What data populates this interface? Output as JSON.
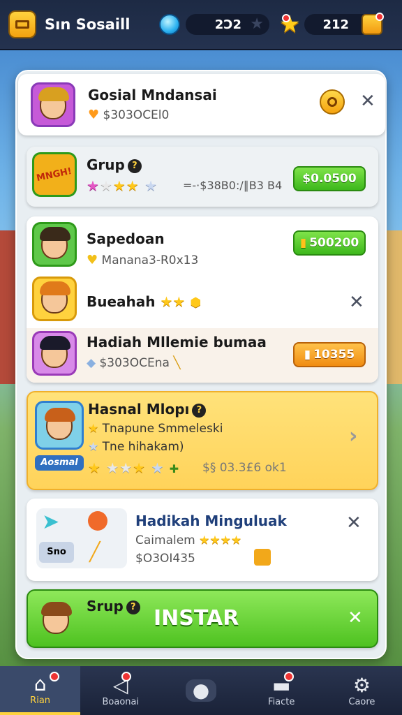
{
  "header": {
    "title": "Sın Sosaill",
    "gems_value": "2Ɔ2",
    "stars_value": "212",
    "colors": {
      "bar": "#1d2a44",
      "gold": "#ffcc1a"
    }
  },
  "cards": {
    "c1": {
      "name": "Gosial Mndansai",
      "sub": "$303OCEl0"
    },
    "c2": {
      "name": "Grup",
      "stars_text": "=-·$38B0:∕∥B3 B4",
      "button": "$0.0500"
    },
    "c3": {
      "name": "Sapedoan",
      "sub": "Manana3-R0x13",
      "button": "500200"
    },
    "c4": {
      "name": "Bueahah"
    },
    "c5": {
      "name": "Hadiah  Mllemie bumaa",
      "sub": "$303OCEna",
      "button": "10355"
    },
    "c6": {
      "name": "Hasnal Mlopı",
      "line1": "Tnapune Smmeleski",
      "line2": "Tne hihakam)",
      "badge": "Aosmal",
      "stars_text": "$§ 03.3£6 ok1"
    },
    "c7": {
      "name": "Hadikah Minguluak",
      "sub1": "Caimalem",
      "sub2": "$O3OI435",
      "tag": "Sno"
    },
    "c8": {
      "name": "Srup",
      "button": "INSTAR"
    }
  },
  "nav": [
    {
      "label": "Rian",
      "icon": "home-icon"
    },
    {
      "label": "Boaonai",
      "icon": "flag-icon"
    },
    {
      "label": "",
      "icon": "controller-icon"
    },
    {
      "label": "Fiacte",
      "icon": "chat-icon"
    },
    {
      "label": "Caore",
      "icon": "gear-icon"
    }
  ]
}
